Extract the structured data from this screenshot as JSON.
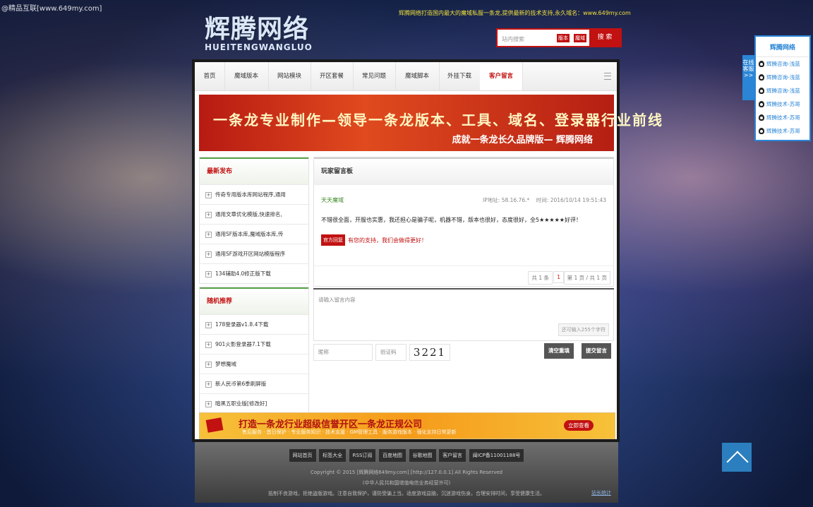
{
  "watermark": "@精品互联[www.649my.com]",
  "header": {
    "logo_cn": "辉腾网络",
    "logo_en": "HUEITENGWANGLUO",
    "notice": "辉腾网络打造国内最大的魔域私服一条龙,提供最新的技术支持,永久域名：www.649my.com",
    "search": {
      "placeholder": "站内搜索",
      "tag1": "版本",
      "tag2": "魔域",
      "button": "搜 索"
    }
  },
  "nav": {
    "items": [
      "首页",
      "魔域版本",
      "网站模块",
      "开区套餐",
      "常见问题",
      "魔域脚本",
      "外挂下载",
      "客户留言"
    ],
    "active_index": 7
  },
  "banner": {
    "line1": "一条龙专业制作—领导一条龙版本、工具、域名、登录器行业前线",
    "line2": "成就一条龙长久品牌版— 辉腾网络"
  },
  "sidebar": {
    "latest": {
      "title": "最新发布",
      "items": [
        "传奇专用版本库网站程序,通用",
        "通用文章优化模版,快速排名,",
        "通用SF版本库,魔域版本库,传",
        "通用SF游戏开区网站模版程序",
        "134辅助4.0修正版下载"
      ]
    },
    "random": {
      "title": "随机推荐",
      "items": [
        "178登录器v1.8.4下载",
        "901火影登录器7.1下载",
        "梦想魔域",
        "新人民币第6季刷屏版",
        "暗黑五职业版[修改好]"
      ]
    }
  },
  "board": {
    "title": "玩家留言板",
    "message": {
      "user": "天天魔域",
      "ip": "IP地址: 58.16.76.*",
      "time": "时间: 2016/10/14 19:51:43",
      "text": "不错很全面，开服也实惠，我还担心是骗子呢，机器不错，版本也很好，态度很好，全5★★★★★好评！",
      "reply_tag": "官方回复",
      "reply_text": "有您的支持，我们会做得更好！"
    },
    "pager": {
      "total": "共 1 条",
      "current": "1",
      "pages": "第 1 页 / 共 1 页"
    }
  },
  "form": {
    "content_placeholder": "请输入留言内容",
    "char_count": "还可输入255个字符",
    "nickname_placeholder": "昵称",
    "captcha_placeholder": "验证码",
    "captcha_value": "3221",
    "reset_button": "清空重填",
    "submit_button": "提交留言"
  },
  "ad": {
    "headline": "打造一条龙行业超级信誉开区一条龙正规公司",
    "sub": "售后服务 · 首日保护 · 专业服务知识 · 技术支援 · GM管理工具 · 服务游戏版本 · 强化支持日常更新",
    "cta": "立即查看"
  },
  "right_panel": {
    "tab": "在线客服 >>",
    "title": "辉腾网络",
    "items": [
      "辉腾咨询-浅蓝",
      "辉腾咨询-浅蓝",
      "辉腾咨询-浅蓝",
      "辉腾技术-苏哥",
      "辉腾技术-苏哥",
      "辉腾技术-苏哥"
    ]
  },
  "footer": {
    "links": [
      "网站首页",
      "标签大全",
      "RSS订阅",
      "百度地图",
      "谷歌地图",
      "客户留言",
      "闽ICP备11001188号"
    ],
    "copyright": "Copyright © 2015 [辉腾网络649my.com] [http://127.0.0.1] All Rights Reserved",
    "license": "(中华人民共和国增值电信业务经营许可)",
    "advice": "抵制不良游戏，拒绝盗版游戏。注意自我保护，谨防受骗上当。适度游戏益脑，沉迷游戏伤身。合理安排时间，享受健康生活。",
    "stats": "站长统计"
  }
}
